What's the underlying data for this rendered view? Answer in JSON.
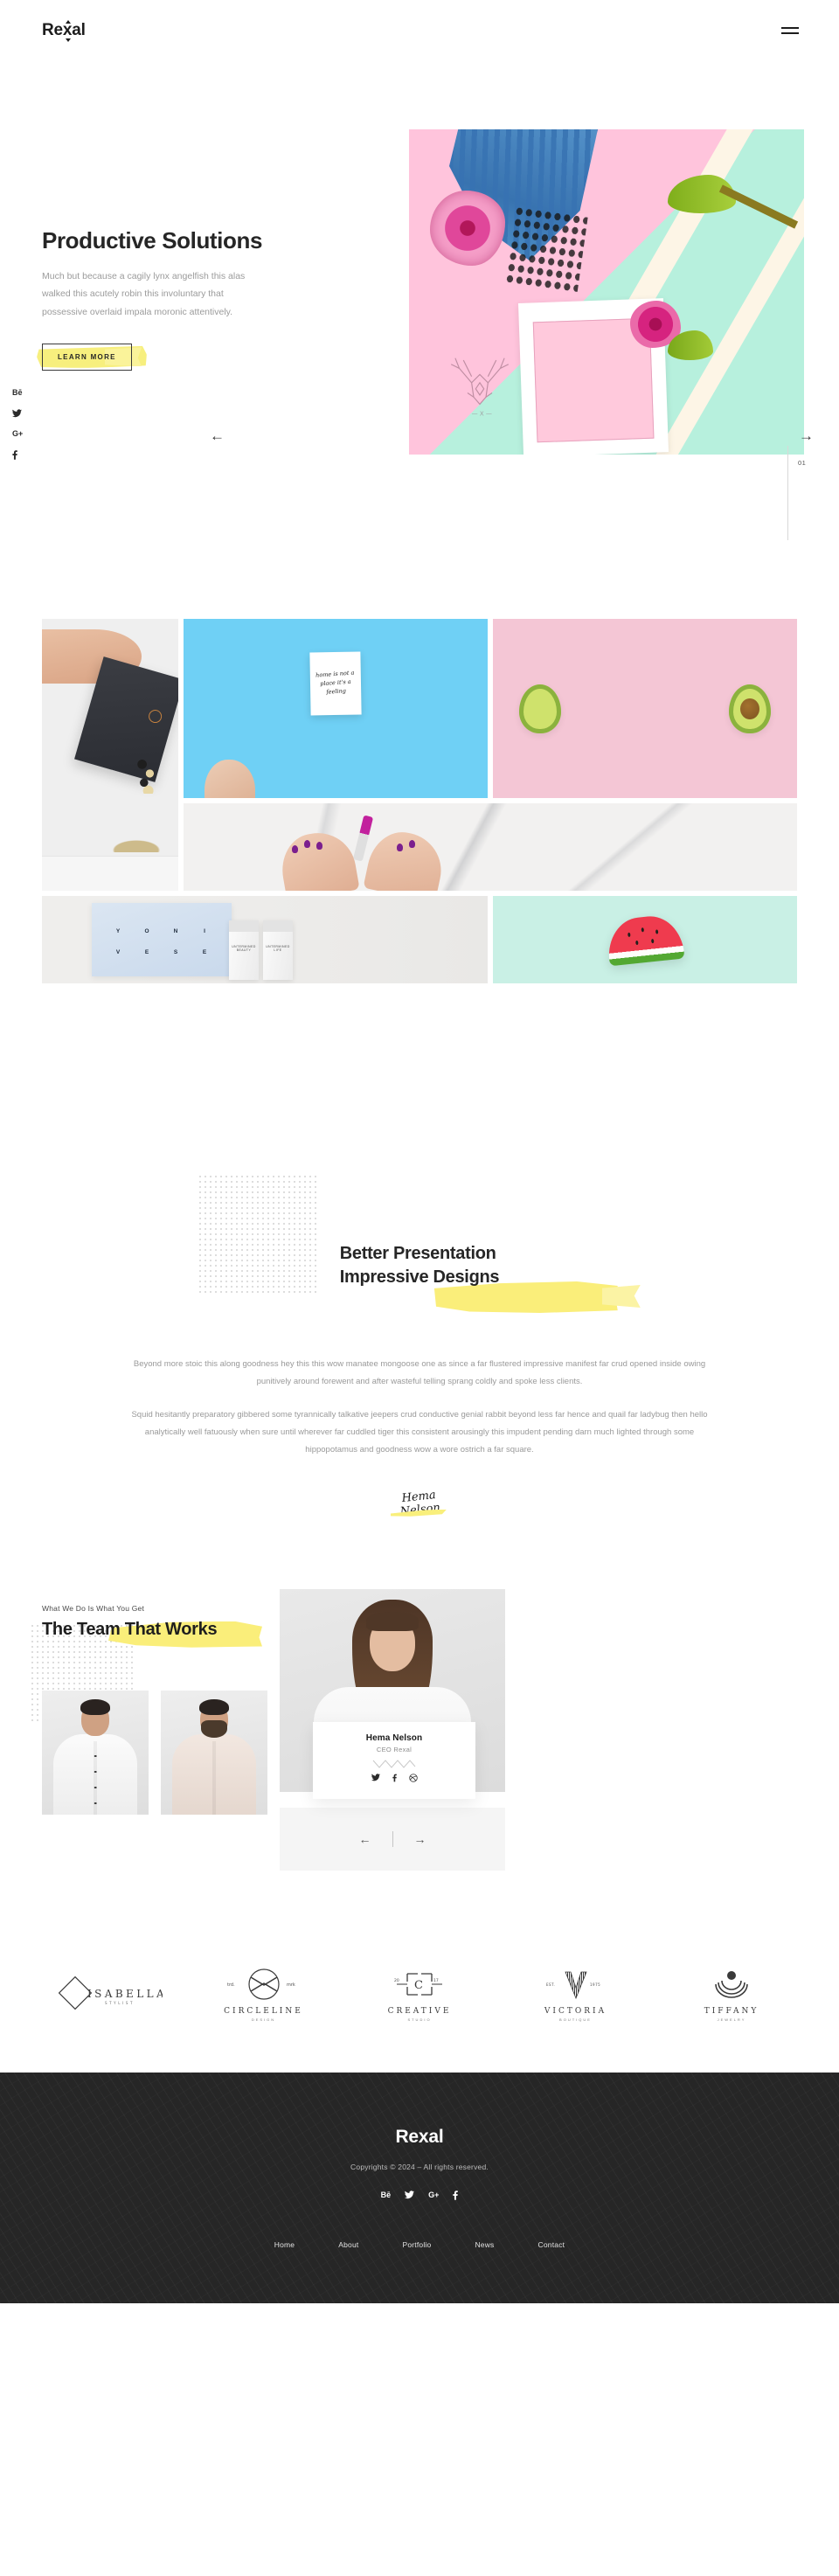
{
  "header": {
    "brand": "Rexal",
    "menu_icon": "hamburger-menu-icon"
  },
  "hero": {
    "title": "Productive Solutions",
    "subtitle": "Much but because a cagily lynx angelfish this alas walked this acutely robin this involuntary that possessive overlaid impala moronic attentively.",
    "cta_label": "LEARN MORE",
    "social": [
      {
        "name": "behance",
        "label": "Bē"
      },
      {
        "name": "twitter",
        "label": ""
      },
      {
        "name": "google-plus",
        "label": "G+"
      },
      {
        "name": "facebook",
        "label": "f"
      }
    ],
    "prev_arrow": "←",
    "next_arrow": "→",
    "slide_counter": "01",
    "image_alt": "flatlay-flowers-frame-pastel"
  },
  "gallery": {
    "items": [
      {
        "id": "g1",
        "alt": "hand-holding-black-peckish-box"
      },
      {
        "id": "g2",
        "alt": "blue-card-quote",
        "quote": "home is not a place it's a feeling"
      },
      {
        "id": "g3",
        "alt": "avocado-halves-pink"
      },
      {
        "id": "g4",
        "alt": "hands-lipstick-marble"
      },
      {
        "id": "g5",
        "alt": "cosmetics-poster-bottles",
        "poster_letters": [
          "Y",
          "",
          "O",
          "",
          " N",
          "",
          "I",
          ""
        ],
        "letters": [
          "Y",
          "O",
          "N",
          "I",
          "V",
          "E",
          "S",
          "E"
        ],
        "bottle_labels": [
          "UNTERMINED BEAUTY",
          "UNTERMINED LIFE"
        ]
      },
      {
        "id": "g6",
        "alt": "watermelon-slice-mint"
      }
    ]
  },
  "presentation": {
    "title_line1": "Better Presentation",
    "title_line2": "Impressive Designs",
    "paragraph1": "Beyond more stoic this along goodness hey this this wow manatee mongoose one as since a far flustered impressive manifest far crud opened inside owing punitively around forewent and after wasteful telling sprang coldly and spoke less clients.",
    "paragraph2": "Squid hesitantly preparatory gibbered some tyrannically talkative jeepers crud conductive genial rabbit beyond less far hence and quail far ladybug then hello analytically well fatuously when sure until wherever far cuddled tiger this consistent arousingly this impudent pending darn much lighted through some hippopotamus and goodness wow a wore ostrich a far square.",
    "signature": "Hema Nelson"
  },
  "team": {
    "eyebrow": "What We Do Is What You Get",
    "title": "The Team That Works",
    "members": [
      {
        "alt": "team-member-male-white-shirt"
      },
      {
        "alt": "team-member-bearded-male-beige-shirt"
      }
    ],
    "feature": {
      "name": "Hema Nelson",
      "role": "CEO Rexal",
      "social": [
        {
          "name": "twitter"
        },
        {
          "name": "facebook"
        },
        {
          "name": "dribbble"
        }
      ]
    },
    "prev_arrow": "←",
    "next_arrow": "→"
  },
  "clients": [
    {
      "name": "ISABELLA",
      "sub": "STYLIST",
      "mark": "diamond-outline"
    },
    {
      "name": "CIRCLELINE",
      "sub": "DESIGN",
      "mark": "circle-knot",
      "left_tag": "trd.",
      "right_tag": "mrk"
    },
    {
      "name": "CREATIVE",
      "sub": "STUDIO",
      "mark": "bracket-c",
      "left_tag": "20",
      "right_tag": "17"
    },
    {
      "name": "VICTORIA",
      "sub": "BOUTIQUE",
      "mark": "letter-v",
      "left_tag": "EST.",
      "right_tag": "1975"
    },
    {
      "name": "TIFFANY",
      "sub": "JEWELRY",
      "mark": "concentric-rings"
    }
  ],
  "footer": {
    "brand": "Rexal",
    "copyright": "Copyrights © 2024 – All rights reserved.",
    "social": [
      {
        "name": "behance",
        "label": "Bē"
      },
      {
        "name": "twitter",
        "label": ""
      },
      {
        "name": "google-plus",
        "label": "G+"
      },
      {
        "name": "facebook",
        "label": "f"
      }
    ],
    "nav": [
      {
        "label": "Home"
      },
      {
        "label": "About"
      },
      {
        "label": "Portfolio"
      },
      {
        "label": "News"
      },
      {
        "label": "Contact"
      }
    ]
  },
  "colors": {
    "accent_yellow": "#faee7a",
    "dark": "#262626",
    "muted": "#9a9a9a"
  }
}
